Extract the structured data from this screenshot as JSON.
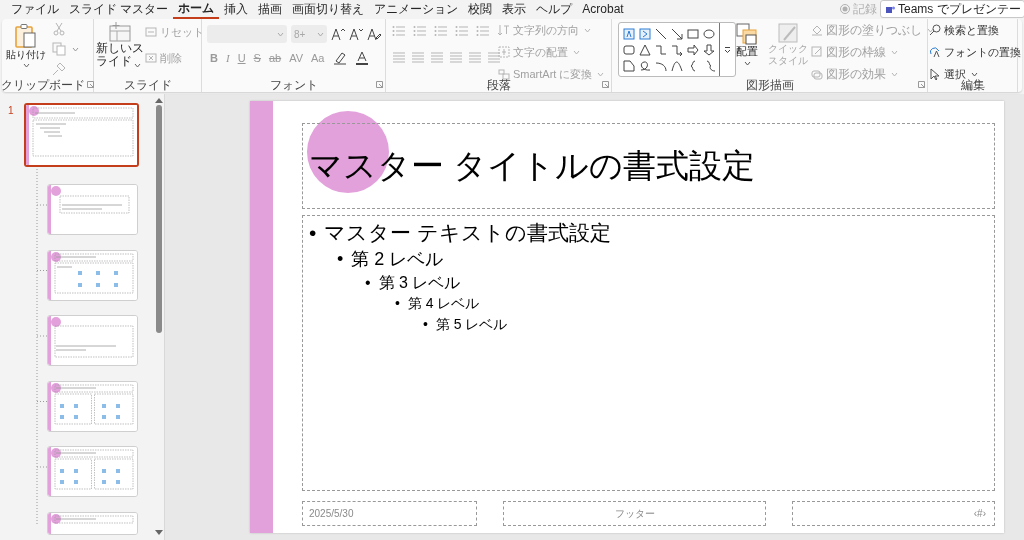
{
  "menu_tabs": [
    {
      "label": "ファイル",
      "selected": false
    },
    {
      "label": "スライド マスター",
      "selected": false
    },
    {
      "label": "ホーム",
      "selected": true
    },
    {
      "label": "挿入",
      "selected": false
    },
    {
      "label": "描画",
      "selected": false
    },
    {
      "label": "画面切り替え",
      "selected": false
    },
    {
      "label": "アニメーション",
      "selected": false
    },
    {
      "label": "校閲",
      "selected": false
    },
    {
      "label": "表示",
      "selected": false
    },
    {
      "label": "ヘルプ",
      "selected": false
    },
    {
      "label": "Acrobat",
      "selected": false
    }
  ],
  "record_button": {
    "label": "記録",
    "disabled": true
  },
  "teams_button": {
    "label": "Teams でプレゼンテー"
  },
  "ribbon": {
    "groups": [
      {
        "kind": "clipboard",
        "label": "クリップボード",
        "paste": {
          "label": "貼り付け"
        },
        "disabled": true
      },
      {
        "kind": "slides",
        "label": "スライド",
        "new_slide": {
          "label": "新しいスライド"
        },
        "items": [
          {
            "label": "リセット",
            "disabled": true
          },
          {
            "label": "削除",
            "disabled": true
          }
        ]
      },
      {
        "kind": "font",
        "label": "フォント",
        "disabled": true,
        "size_value": "8+",
        "format_buttons": [
          "B",
          "I",
          "U",
          "S",
          "ab",
          "AV",
          "Aa"
        ]
      },
      {
        "kind": "paragraph",
        "label": "段落",
        "items": [
          {
            "label": "文字列の方向",
            "disabled": true
          },
          {
            "label": "文字の配置",
            "disabled": true
          },
          {
            "label": "SmartArt に変換",
            "disabled": true
          }
        ]
      },
      {
        "kind": "drawing",
        "label": "図形描画",
        "arrange": {
          "label": "配置"
        },
        "quick_styles": {
          "label": "クイックスタイル",
          "disabled": true
        },
        "items": [
          {
            "label": "図形の塗りつぶし",
            "disabled": true
          },
          {
            "label": "図形の枠線",
            "disabled": true
          },
          {
            "label": "図形の効果",
            "disabled": true
          }
        ]
      },
      {
        "kind": "editing",
        "label": "編集",
        "items": [
          {
            "label": "検索と置換",
            "disabled": false
          },
          {
            "label": "フォントの置換",
            "disabled": false
          },
          {
            "label": "選択",
            "disabled": false
          }
        ]
      }
    ]
  },
  "thumbnails": {
    "number": "1",
    "items": [
      {
        "kind": "master",
        "selected": true
      },
      {
        "kind": "title",
        "selected": false
      },
      {
        "kind": "content",
        "selected": false
      },
      {
        "kind": "section",
        "selected": false
      },
      {
        "kind": "two_content",
        "selected": false
      },
      {
        "kind": "comparison",
        "selected": false
      },
      {
        "kind": "title_only",
        "selected": false
      }
    ]
  },
  "slide": {
    "title": "マスター タイトルの書式設定",
    "body": [
      {
        "bullet": "•",
        "text": "マスター テキストの書式設定",
        "children": [
          {
            "bullet": "•",
            "text": "第 2 レベル",
            "children": [
              {
                "bullet": "•",
                "text": "第 3 レベル",
                "children": [
                  {
                    "bullet": "•",
                    "text": "第 4 レベル",
                    "children": [
                      {
                        "bullet": "•",
                        "text": "第 5 レベル"
                      }
                    ]
                  }
                ]
              }
            ]
          }
        ]
      }
    ],
    "footer": {
      "date": "2025/5/30",
      "text": "フッター",
      "number": "‹#›"
    }
  }
}
